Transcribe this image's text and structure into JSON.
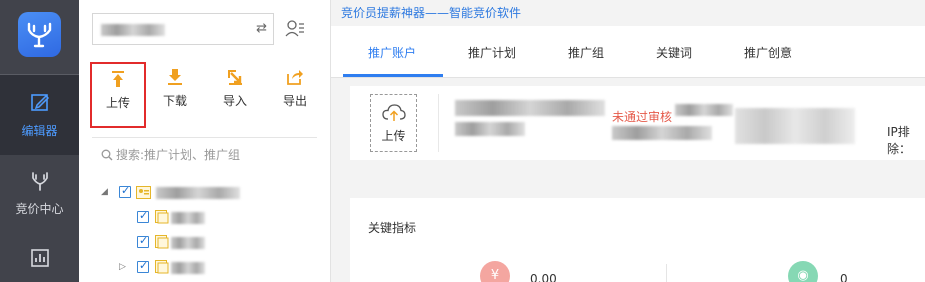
{
  "window": {
    "subtitle": "竞价员提薪神器——智能竞价软件"
  },
  "rail": {
    "items": [
      {
        "label": "编辑器",
        "icon": "edit-icon",
        "active": true
      },
      {
        "label": "竞价中心",
        "icon": "antler-icon",
        "active": false
      },
      {
        "label": "",
        "icon": "report-chart-icon",
        "active": false
      }
    ]
  },
  "toolbar": {
    "upload": "上传",
    "download": "下载",
    "import": "导入",
    "export": "导出"
  },
  "search": {
    "placeholder": "搜索:推广计划、推广组"
  },
  "tabs": [
    "推广账户",
    "推广计划",
    "推广组",
    "关键词",
    "推广创意"
  ],
  "account_card": {
    "upload_label": "上传",
    "status_text": "未通过审核",
    "ip_label": "IP排除："
  },
  "kpi": {
    "title": "关键指标",
    "items": [
      {
        "icon": "yen-icon",
        "value": "0.00",
        "color": "#f4a6a0"
      },
      {
        "icon": "eye-icon",
        "value": "0",
        "color": "#86d8b4"
      }
    ]
  },
  "colors": {
    "accent": "#2f7ef0",
    "highlight_border": "#e22b2b",
    "rail_bg": "#41434b"
  }
}
